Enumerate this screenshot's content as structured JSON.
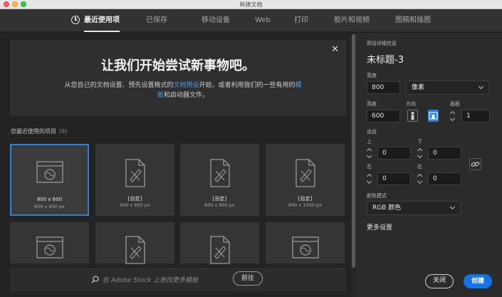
{
  "window": {
    "title": "新建文档"
  },
  "tabs": [
    {
      "label": "最近使用项",
      "active": true
    },
    {
      "label": "已保存"
    },
    {
      "label": "移动设备"
    },
    {
      "label": "Web"
    },
    {
      "label": "打印"
    },
    {
      "label": "胶片和视频"
    },
    {
      "label": "图稿和插图"
    }
  ],
  "banner": {
    "title": "让我们开始尝试新事物吧。",
    "text_part1": "从您自己的文档设置、预先设置格式的",
    "link1": "文档预设",
    "text_part2": "开始，或者利用我们的一些有用的",
    "link2": "模板",
    "text_part3": "和启动器文件。"
  },
  "recent": {
    "label": "您最近使用的项目",
    "count": "(9)",
    "items": [
      {
        "name": "800 x 600",
        "size": "800 x 600 px",
        "icon": "web-document-icon",
        "selected": true
      },
      {
        "name": "[自定]",
        "size": "900 x 600 px",
        "icon": "custom-document-icon"
      },
      {
        "name": "[自定]",
        "size": "800 x 800 px",
        "icon": "custom-document-icon"
      },
      {
        "name": "[自定]",
        "size": "800 x 1000 px",
        "icon": "custom-document-icon"
      },
      {
        "icon": "web-document-icon"
      },
      {
        "icon": "custom-document-icon"
      },
      {
        "icon": "custom-document-icon"
      },
      {
        "icon": "web-document-icon"
      }
    ]
  },
  "stock": {
    "placeholder": "在 Adobe Stock 上查找更多模板",
    "go_label": "前往"
  },
  "preset": {
    "section_label": "预设详细信息",
    "doc_name": "未标题-3",
    "width_label": "宽度",
    "width_value": "800",
    "unit_value": "像素",
    "height_label": "高度",
    "height_value": "600",
    "orientation_label": "方向",
    "artboard_label": "画板",
    "artboard_value": "1",
    "bleed_label": "出血",
    "top_label": "上",
    "top_value": "0",
    "bottom_label": "下",
    "bottom_value": "0",
    "left_label": "左",
    "left_value": "0",
    "right_label": "右",
    "right_value": "0",
    "color_mode_label": "颜色模式",
    "color_mode_value": "RGB 颜色",
    "more_settings": "更多设置"
  },
  "actions": {
    "close_label": "关闭",
    "create_label": "创建"
  },
  "colors": {
    "accent": "#1473e6",
    "selection": "#2d82d7",
    "link": "#4d9be6"
  }
}
